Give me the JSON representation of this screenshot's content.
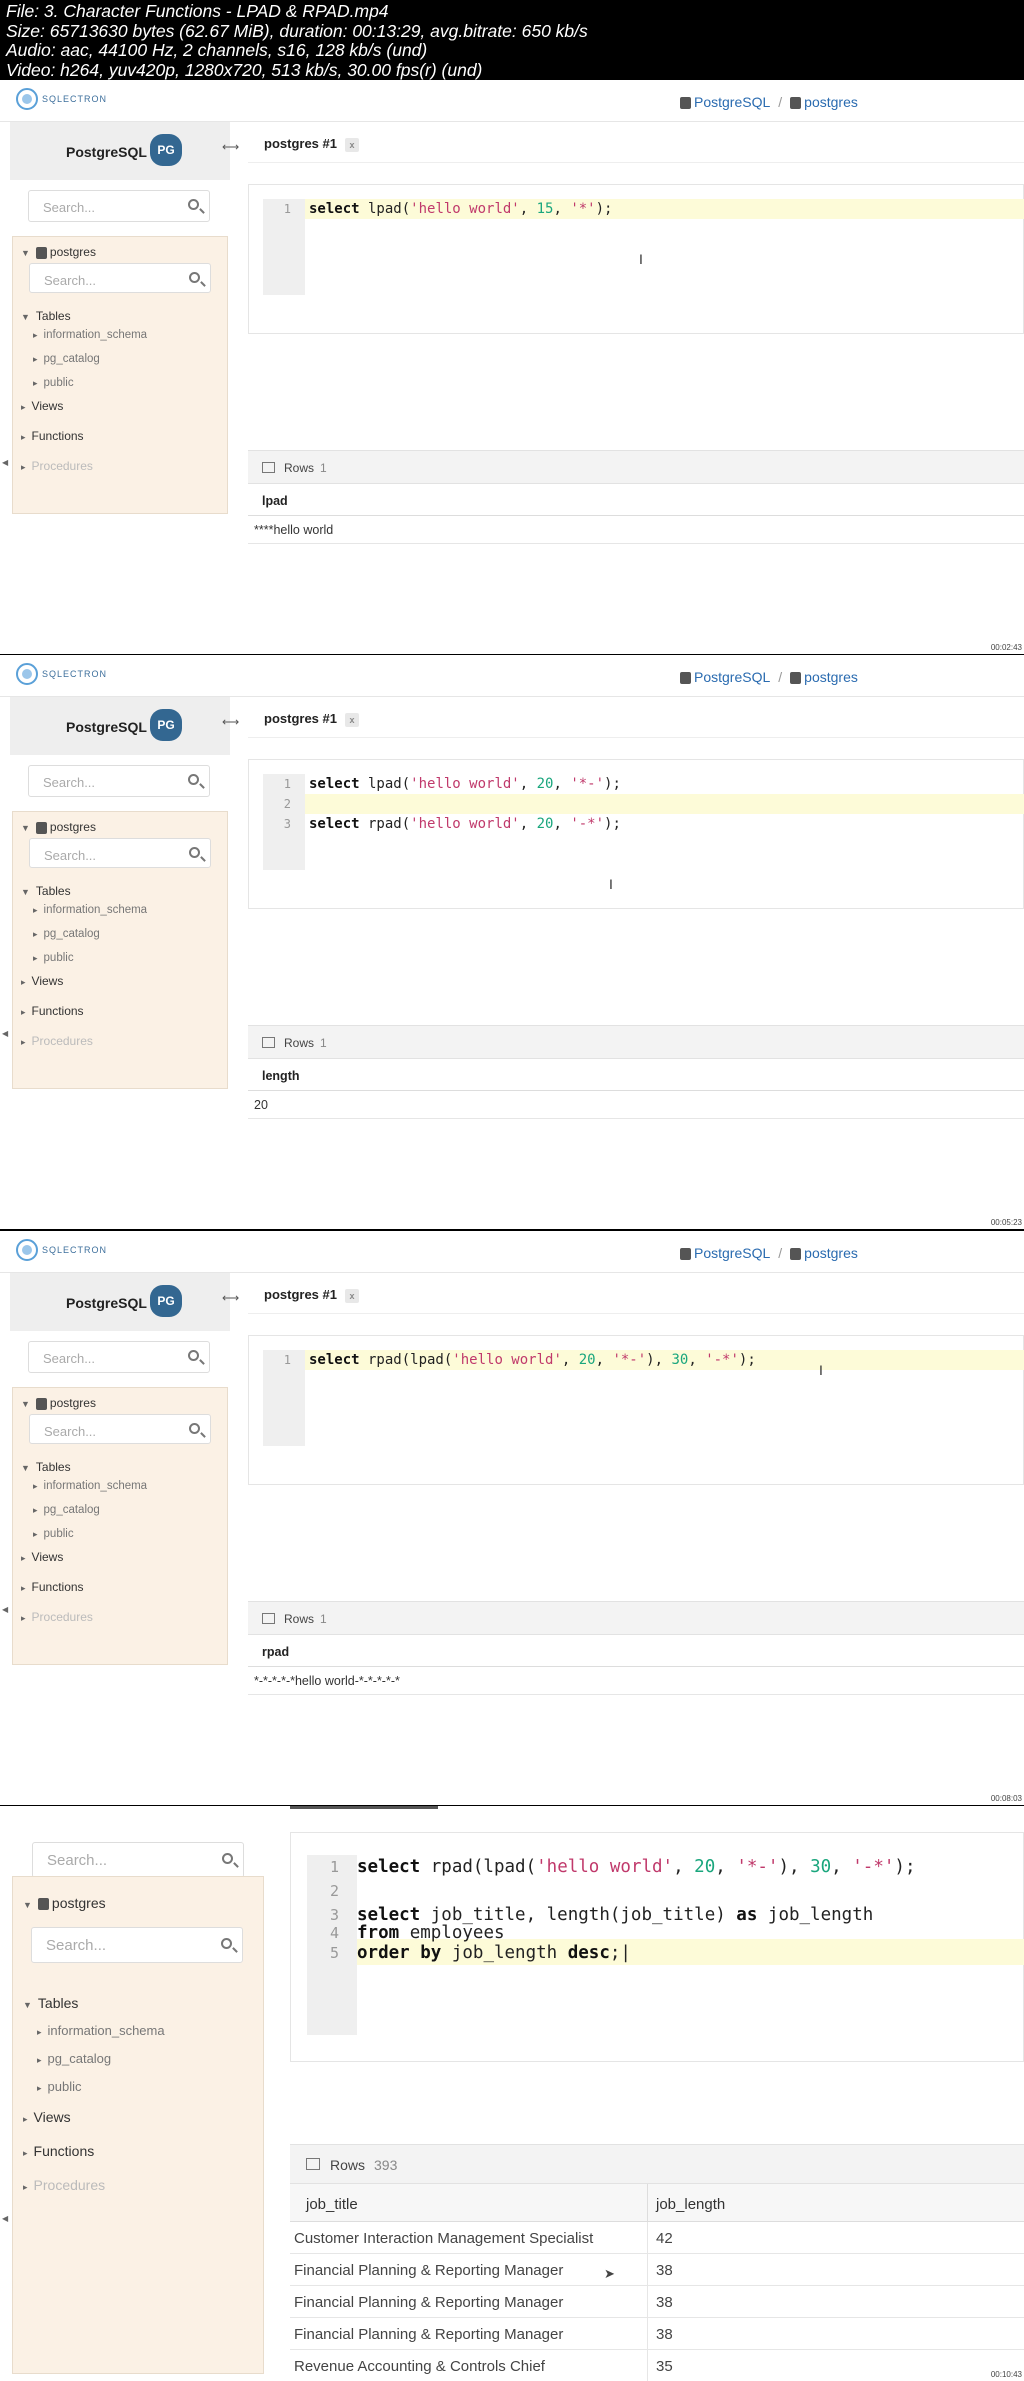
{
  "meta": {
    "line1": "File: 3. Character Functions - LPAD & RPAD.mp4",
    "line2": "Size: 65713630 bytes (62.67 MiB), duration: 00:13:29, avg.bitrate: 650 kb/s",
    "line3": "Audio: aac, 44100 Hz, 2 channels, s16, 128 kb/s (und)",
    "line4": "Video: h264, yuv420p, 1280x720, 513 kb/s, 30.00 fps(r) (und)"
  },
  "app": {
    "logo": "SQLECTRON",
    "crumb_server": "PostgreSQL",
    "crumb_db": "postgres",
    "side_title": "PostgreSQL",
    "tab": "postgres #1",
    "tab_close": "x"
  },
  "sidebar": {
    "search_placeholder": "Search...",
    "db": "postgres",
    "db_search_placeholder": "Search...",
    "tables": "Tables",
    "schemas": [
      "information_schema",
      "pg_catalog",
      "public"
    ],
    "views": "Views",
    "functions": "Functions",
    "procedures": "Procedures"
  },
  "rows_label": "Rows",
  "frames": [
    {
      "stamp": "00:02:43",
      "rows_count": "1",
      "column": "lpad",
      "result": "****hello world"
    },
    {
      "stamp": "00:05:23",
      "rows_count": "1",
      "column": "length",
      "result": "20"
    },
    {
      "stamp": "00:08:03",
      "rows_count": "1",
      "column": "rpad",
      "result": "*-*-*-*-*hello world-*-*-*-*-*"
    },
    {
      "stamp": "00:10:43",
      "rows_count": "393",
      "columns": [
        "job_title",
        "job_length"
      ],
      "rows": [
        [
          "Customer Interaction Management Specialist",
          "42"
        ],
        [
          "Financial Planning & Reporting Manager",
          "38"
        ],
        [
          "Financial Planning & Reporting Manager",
          "38"
        ],
        [
          "Financial Planning & Reporting Manager",
          "38"
        ],
        [
          "Revenue Accounting & Controls Chief",
          "35"
        ]
      ]
    }
  ]
}
